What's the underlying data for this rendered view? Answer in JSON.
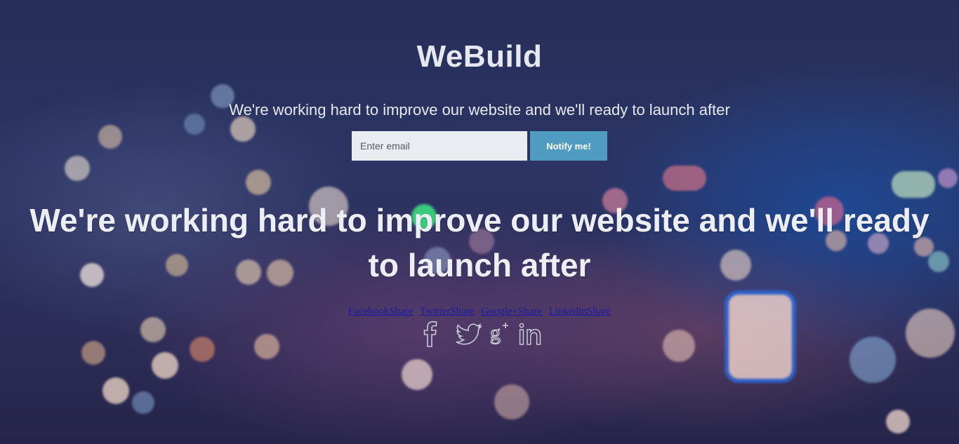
{
  "brand": {
    "title": "WeBuild"
  },
  "hero": {
    "tagline": "We're working hard to improve our website and we'll ready to launch after",
    "headline": "We're working hard to improve our website and we'll ready to launch after"
  },
  "signup": {
    "email_placeholder": "Enter email",
    "email_value": "",
    "notify_label": "Notify me!"
  },
  "share": {
    "links": [
      {
        "label": "FacebookShare"
      },
      {
        "label": "TwitterShare"
      },
      {
        "label": "Google+Share"
      },
      {
        "label": "LinkedinShare"
      }
    ],
    "icons": [
      "facebook-icon",
      "twitter-icon",
      "google-plus-icon",
      "linkedin-icon"
    ]
  },
  "colors": {
    "accent": "#4f9bc1",
    "input_bg": "#e9ecf1",
    "text": "#e6e8f0",
    "link": "#1a1aa8"
  }
}
